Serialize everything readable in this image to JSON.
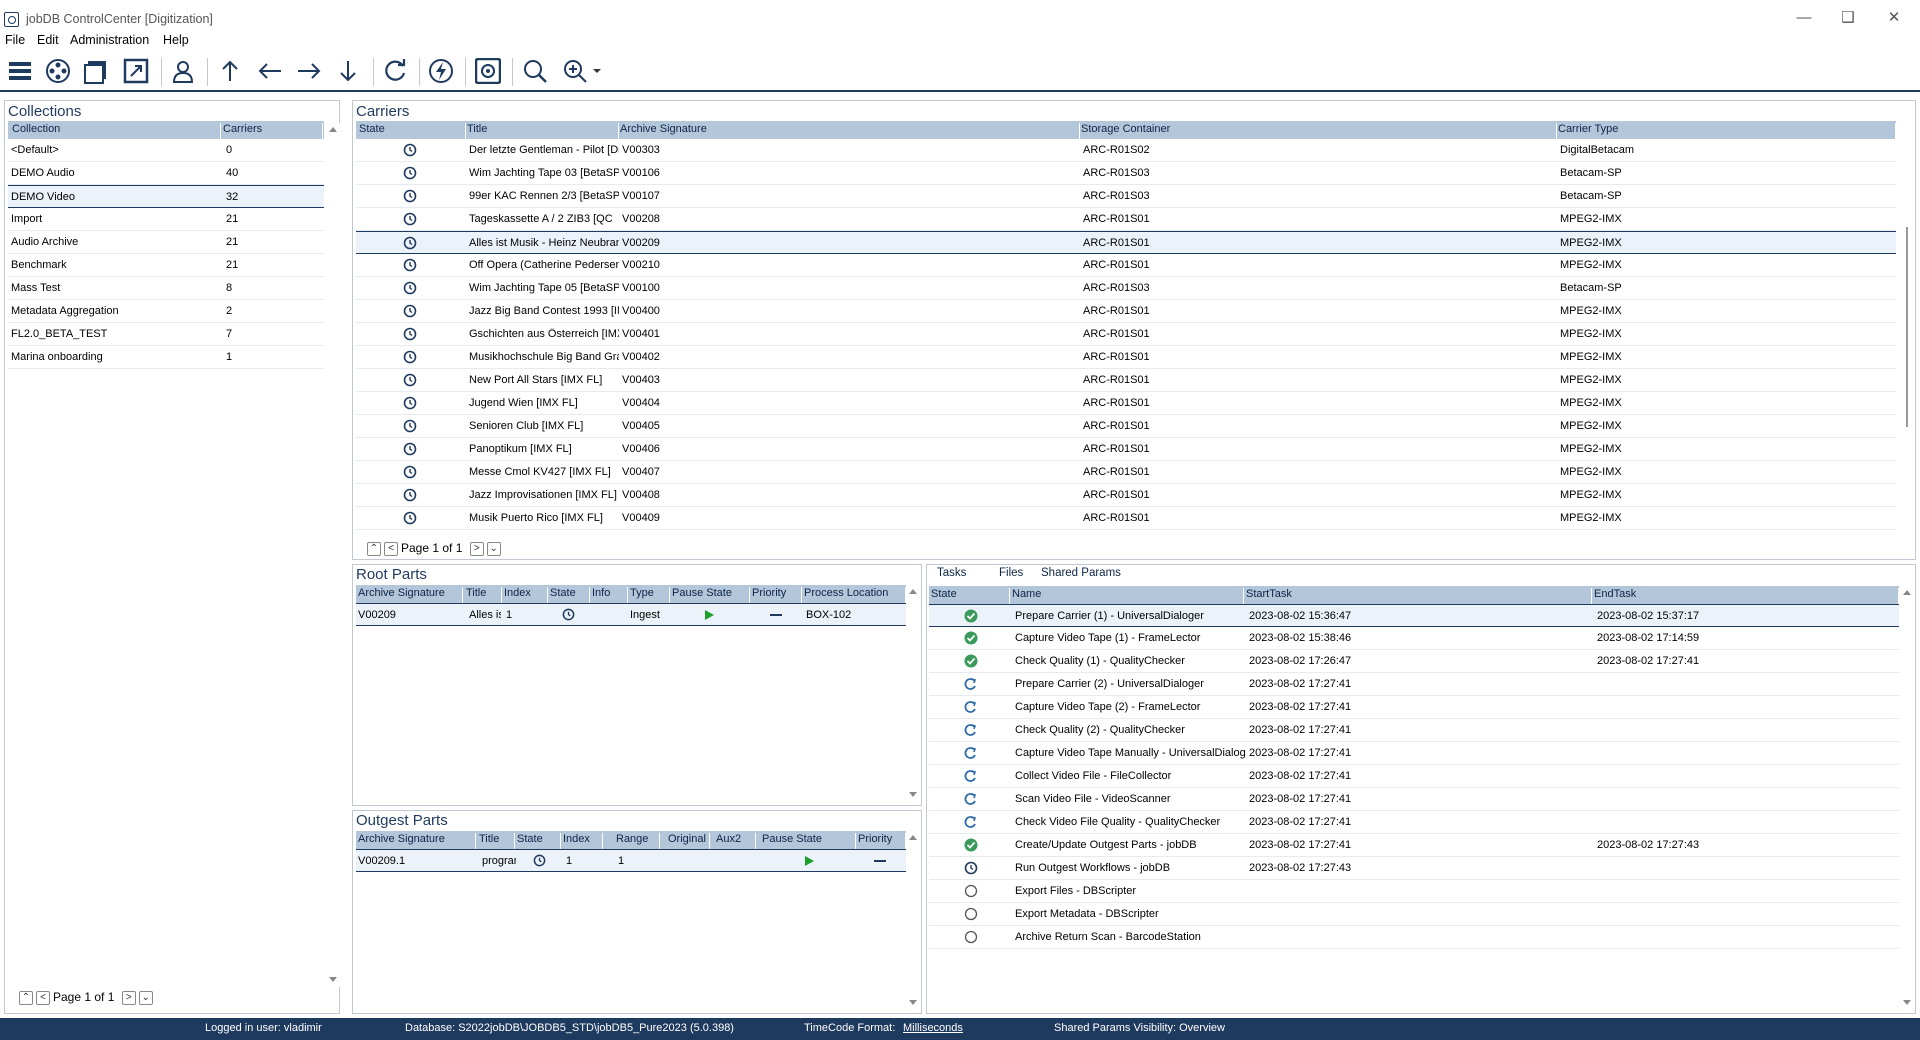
{
  "window": {
    "title": "jobDB ControlCenter [Digitization]"
  },
  "menu": [
    "File",
    "Edit",
    "Administration",
    "Help"
  ],
  "toolbar": [
    "menu-icon",
    "film-reel-icon",
    "carrier-icon",
    "export-icon",
    "user-icon",
    "arrow-up-icon",
    "arrow-left-icon",
    "arrow-right-icon",
    "arrow-down-icon",
    "refresh-icon",
    "lightning-icon",
    "safe-icon",
    "zoom-icon",
    "zoom-options-icon"
  ],
  "collections": {
    "title": "Collections",
    "columns": [
      "Collection",
      "Carriers"
    ],
    "rows": [
      [
        "<Default>",
        "0"
      ],
      [
        "DEMO Audio",
        "40"
      ],
      [
        "DEMO Video",
        "32"
      ],
      [
        "Import",
        "21"
      ],
      [
        "Audio Archive",
        "21"
      ],
      [
        "Benchmark",
        "21"
      ],
      [
        "Mass Test",
        "8"
      ],
      [
        "Metadata Aggregation",
        "2"
      ],
      [
        "FL2.0_BETA_TEST",
        "7"
      ],
      [
        "Marina onboarding",
        "1"
      ]
    ],
    "selected_index": 2,
    "pager": "Page 1 of 1"
  },
  "carriers": {
    "title": "Carriers",
    "columns": [
      "State",
      "Title",
      "Archive Signature",
      "Storage Container",
      "Carrier Type"
    ],
    "rows": [
      [
        "Der letzte Gentleman - Pilot [Di",
        "V00303",
        "ARC-R01S02",
        "DigitalBetacam"
      ],
      [
        "Wim Jachting Tape 03 [BetaSP",
        "V00106",
        "ARC-R01S03",
        "Betacam-SP"
      ],
      [
        "99er KAC Rennen 2/3 [BetaSP",
        "V00107",
        "ARC-R01S03",
        "Betacam-SP"
      ],
      [
        " Tageskassette A / 2  ZIB3 [QC",
        "V00208",
        "ARC-R01S01",
        "MPEG2-IMX"
      ],
      [
        "Alles ist Musik - Heinz Neubranc",
        "V00209",
        "ARC-R01S01",
        "MPEG2-IMX"
      ],
      [
        "Off Opera (Catherine Pedersen",
        "V00210",
        "ARC-R01S01",
        "MPEG2-IMX"
      ],
      [
        "Wim Jachting Tape 05 [BetaSP",
        "V00100",
        "ARC-R01S03",
        "Betacam-SP"
      ],
      [
        "Jazz Big Band Contest 1993 [IM",
        "V00400",
        "ARC-R01S01",
        "MPEG2-IMX"
      ],
      [
        "Gschichten aus Österreich [IMX",
        "V00401",
        "ARC-R01S01",
        "MPEG2-IMX"
      ],
      [
        "Musikhochschule Big Band Graz",
        "V00402",
        "ARC-R01S01",
        "MPEG2-IMX"
      ],
      [
        "New Port All Stars [IMX FL]",
        "V00403",
        "ARC-R01S01",
        "MPEG2-IMX"
      ],
      [
        "Jugend Wien [IMX FL]",
        "V00404",
        "ARC-R01S01",
        "MPEG2-IMX"
      ],
      [
        "Senioren Club [IMX FL]",
        "V00405",
        "ARC-R01S01",
        "MPEG2-IMX"
      ],
      [
        "Panoptikum [IMX FL]",
        "V00406",
        "ARC-R01S01",
        "MPEG2-IMX"
      ],
      [
        "Messe Cmol KV427 [IMX FL]",
        "V00407",
        "ARC-R01S01",
        "MPEG2-IMX"
      ],
      [
        "Jazz Improvisationen [IMX FL]",
        "V00408",
        "ARC-R01S01",
        "MPEG2-IMX"
      ],
      [
        "Musik Puerto Rico [IMX FL]",
        "V00409",
        "ARC-R01S01",
        "MPEG2-IMX"
      ]
    ],
    "selected_index": 4,
    "pager": "Page 1 of 1"
  },
  "root_parts": {
    "title": "Root Parts",
    "columns": [
      "Archive Signature",
      "Title",
      "Index",
      "State",
      "Info",
      "Type",
      "Pause State",
      "Priority",
      "Process Location"
    ],
    "rows": [
      [
        "V00209",
        "Alles is",
        "1",
        "",
        "",
        "Ingest",
        "",
        "",
        "BOX-102"
      ]
    ]
  },
  "outgest_parts": {
    "title": "Outgest Parts",
    "columns": [
      "Archive Signature",
      "Title",
      "State",
      "Index",
      "Range",
      "Original",
      "Aux2",
      "Pause State",
      "Priority"
    ],
    "rows": [
      [
        "V00209.1",
        "prograr",
        "",
        "1",
        "1",
        "",
        "",
        "",
        ""
      ]
    ]
  },
  "tasks_panel": {
    "tabs": [
      "Tasks",
      "Files",
      "Shared Params"
    ],
    "columns": [
      "State",
      "Name",
      "StartTask",
      "EndTask"
    ],
    "rows": [
      {
        "state": "done",
        "name": "Prepare Carrier (1) - UniversalDialoger",
        "start": "2023-08-02 15:36:47",
        "end": "2023-08-02 15:37:17"
      },
      {
        "state": "done",
        "name": "Capture Video Tape (1) - FrameLector",
        "start": "2023-08-02 15:38:46",
        "end": "2023-08-02 17:14:59"
      },
      {
        "state": "done",
        "name": "Check Quality (1) - QualityChecker",
        "start": "2023-08-02 17:26:47",
        "end": "2023-08-02 17:27:41"
      },
      {
        "state": "retry",
        "name": "Prepare Carrier (2) - UniversalDialoger",
        "start": "2023-08-02 17:27:41",
        "end": ""
      },
      {
        "state": "retry",
        "name": "Capture Video Tape (2) - FrameLector",
        "start": "2023-08-02 17:27:41",
        "end": ""
      },
      {
        "state": "retry",
        "name": "Check Quality (2) - QualityChecker",
        "start": "2023-08-02 17:27:41",
        "end": ""
      },
      {
        "state": "retry",
        "name": "Capture Video Tape Manually - UniversalDialoge",
        "start": "2023-08-02 17:27:41",
        "end": ""
      },
      {
        "state": "retry",
        "name": "Collect Video File - FileCollector",
        "start": "2023-08-02 17:27:41",
        "end": ""
      },
      {
        "state": "retry",
        "name": "Scan Video File - VideoScanner",
        "start": "2023-08-02 17:27:41",
        "end": ""
      },
      {
        "state": "retry",
        "name": "Check Video File Quality - QualityChecker",
        "start": "2023-08-02 17:27:41",
        "end": ""
      },
      {
        "state": "done",
        "name": "Create/Update Outgest Parts - jobDB",
        "start": "2023-08-02 17:27:41",
        "end": "2023-08-02 17:27:43"
      },
      {
        "state": "running",
        "name": "Run Outgest Workflows - jobDB",
        "start": "2023-08-02 17:27:43",
        "end": ""
      },
      {
        "state": "pending",
        "name": "Export Files - DBScripter",
        "start": "",
        "end": ""
      },
      {
        "state": "pending",
        "name": "Export Metadata - DBScripter",
        "start": "",
        "end": ""
      },
      {
        "state": "pending",
        "name": "Archive Return Scan - BarcodeStation",
        "start": "",
        "end": ""
      }
    ]
  },
  "status": {
    "logged_in": "Logged in user: vladimir",
    "database": "Database: S2022jobDB\\JOBDB5_STD\\jobDB5_Pure2023 (5.0.398)",
    "timecode_label": "TimeCode Format:",
    "timecode_value": "Milliseconds",
    "shared_params": "Shared Params Visibility: Overview"
  },
  "colors": {
    "accent": "#1f3a5f",
    "header": "#b4c6da",
    "ok": "#3a9a5b",
    "play": "#1e9e2a"
  }
}
